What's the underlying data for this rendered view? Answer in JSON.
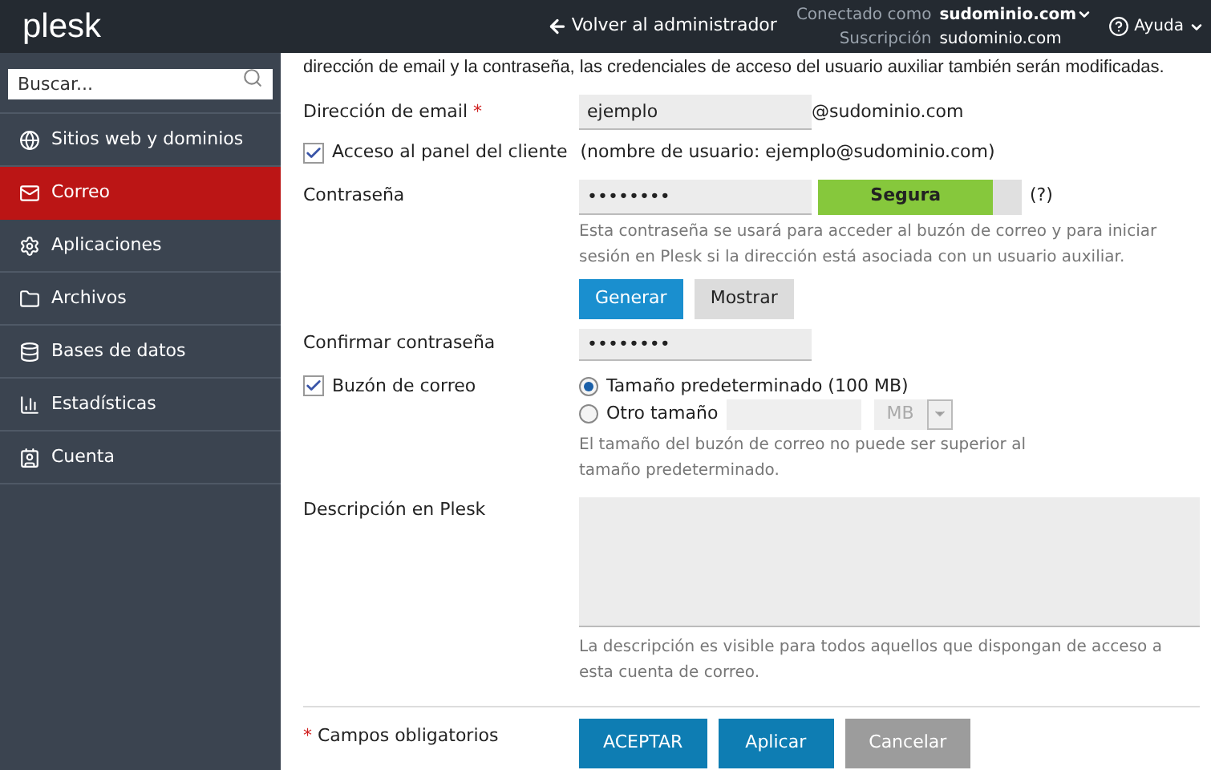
{
  "header": {
    "logo": "plesk",
    "back_link": "Volver al administrador",
    "connected_label": "Conectado como",
    "connected_value": "sudominio.com",
    "subscription_label": "Suscripción",
    "subscription_value": "sudominio.com",
    "help": "Ayuda"
  },
  "sidebar": {
    "search": {
      "placeholder": "Buscar..."
    },
    "items": [
      {
        "label": "Sitios web y dominios",
        "selected": false
      },
      {
        "label": "Correo",
        "selected": true
      },
      {
        "label": "Aplicaciones",
        "selected": false
      },
      {
        "label": "Archivos",
        "selected": false
      },
      {
        "label": "Bases de datos",
        "selected": false
      },
      {
        "label": "Estadísticas",
        "selected": false
      },
      {
        "label": "Cuenta",
        "selected": false
      }
    ]
  },
  "intro": "dirección de email y la contraseña, las credenciales de acceso del usuario auxiliar también serán modificadas.",
  "form": {
    "email": {
      "label": "Dirección de email",
      "required_mark": "*",
      "value": "ejemplo",
      "domain": "@sudominio.com"
    },
    "panel_access": {
      "label": "Acceso al panel del cliente",
      "checked": true,
      "note": "(nombre de usuario: ejemplo@sudominio.com)"
    },
    "password": {
      "label": "Contraseña",
      "value": "••••••••",
      "strength": {
        "label": "Segura",
        "level": 0.86
      },
      "help": "(?)",
      "hint": "Esta contraseña se usará para acceder al buzón de correo y para iniciar sesión en Plesk si la dirección está asociada con un usuario auxiliar.",
      "buttons": [
        "Generar",
        "Mostrar"
      ]
    },
    "confirm": {
      "label": "Confirmar contraseña",
      "value": "••••••••"
    },
    "mailbox": {
      "label": "Buzón de correo",
      "checked": true,
      "options": [
        {
          "label": "Tamaño predeterminado (100 MB)",
          "selected": true
        },
        {
          "label": "Otro tamaño",
          "selected": false
        }
      ],
      "unit": "MB",
      "hint": "El tamaño del buzón de correo no puede ser superior al tamaño predeterminado."
    },
    "description": {
      "label": "Descripción en Plesk",
      "hint": "La descripción es visible para todos aquellos que dispongan de acceso a esta cuenta de correo."
    },
    "footer": {
      "required_mark": "*",
      "required_note": "Campos obligatorios",
      "buttons": [
        {
          "label": "ACEPTAR",
          "kind": "primary"
        },
        {
          "label": "Aplicar",
          "kind": "primary"
        },
        {
          "label": "Cancelar",
          "kind": "cancel"
        }
      ]
    }
  }
}
